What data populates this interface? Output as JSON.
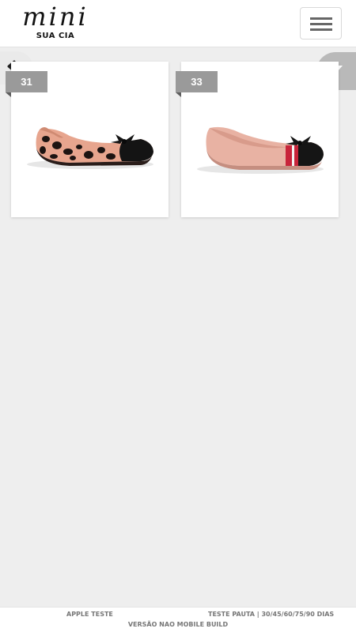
{
  "header": {
    "logo_main": "mini",
    "logo_sub": "SUA CIA",
    "menu_icon": "hamburger-icon"
  },
  "nav": {
    "back_icon": "back-arrow-icon",
    "filter_icon": "filter-icon"
  },
  "products": [
    {
      "size": "31",
      "image": "leopard-print-ballet-flat-with-black-toe-and-bow"
    },
    {
      "size": "33",
      "image": "pink-ballet-flat-with-black-toe-and-striped-band"
    }
  ],
  "footer": {
    "left": "APPLE TESTE",
    "right": "TESTE PAUTA | 30/45/60/75/90 DIAS",
    "center": "VERSÃO NAO MOBILE BUILD"
  },
  "colors": {
    "background": "#eeeeee",
    "tag": "#9a9a9a",
    "filter_button": "#b9b9b9"
  }
}
